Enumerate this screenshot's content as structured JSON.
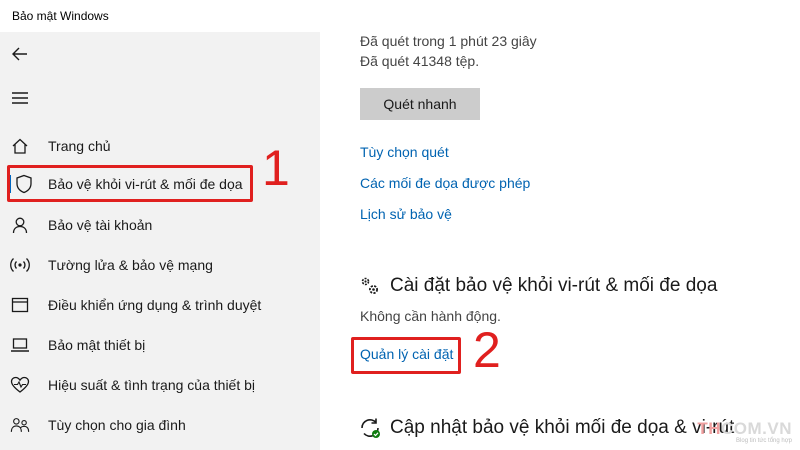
{
  "window": {
    "title": "Bảo mật Windows"
  },
  "sidebar": {
    "items": [
      {
        "label": "Trang chủ",
        "icon": "home-icon"
      },
      {
        "label": "Bảo vệ khỏi vi-rút & mối đe dọa",
        "icon": "shield-icon",
        "selected": true
      },
      {
        "label": "Bảo vệ tài khoản",
        "icon": "person-icon"
      },
      {
        "label": "Tường lửa & bảo vệ mạng",
        "icon": "wifi-icon"
      },
      {
        "label": "Điều khiển ứng dụng & trình duyệt",
        "icon": "app-browser-icon"
      },
      {
        "label": "Bảo mật thiết bị",
        "icon": "laptop-icon"
      },
      {
        "label": "Hiệu suất & tình trạng của thiết bị",
        "icon": "heart-icon"
      },
      {
        "label": "Tùy chọn cho gia đình",
        "icon": "family-icon"
      }
    ]
  },
  "main": {
    "scan_duration": "Đã quét trong 1 phút 23 giây",
    "scan_files": "Đã quét 41348 tệp.",
    "quick_scan_button": "Quét nhanh",
    "links": {
      "scan_options": "Tùy chọn quét",
      "allowed_threats": "Các mối đe dọa được phép",
      "protection_history": "Lịch sử bảo vệ"
    },
    "settings_section": {
      "heading": "Cài đặt bảo vệ khỏi vi-rút & mối đe dọa",
      "status": "Không cần hành động.",
      "manage_link": "Quản lý cài đặt"
    },
    "updates_section": {
      "heading": "Cập nhật bảo vệ khỏi mối đe dọa & vi-rút"
    }
  },
  "annotations": {
    "marker_1": "1",
    "marker_2": "2",
    "color": "#e0201f"
  },
  "watermark": {
    "brand": "TH",
    "name": "COM.VN",
    "tagline": "Blog tin tức tổng hợp"
  },
  "colors": {
    "accent": "#0067c0",
    "link": "#0063b1",
    "sidebar_bg": "#f2f2f2"
  }
}
